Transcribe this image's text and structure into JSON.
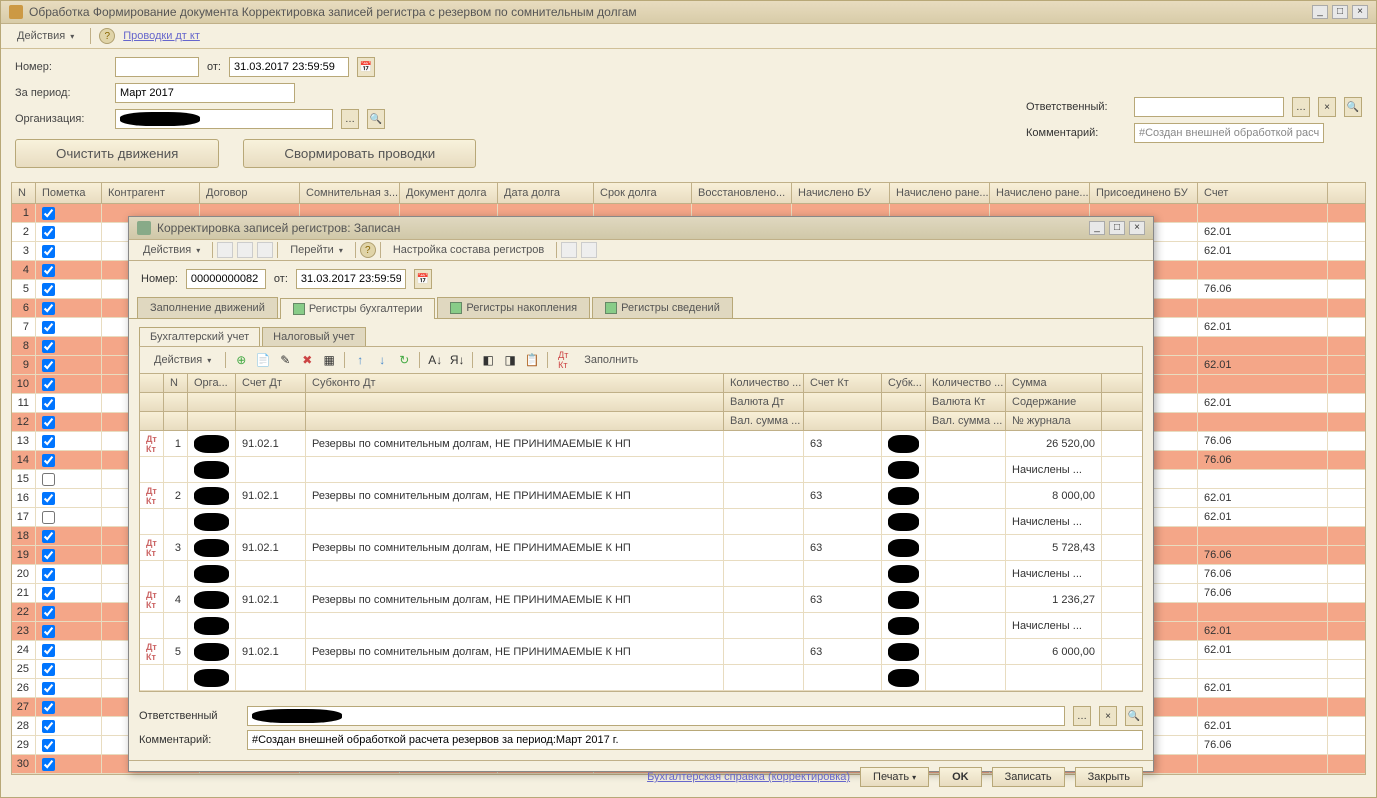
{
  "main": {
    "title": "Обработка  Формирование документа Корректировка записей регистра с резервом по сомнительным долгам",
    "toolbar": {
      "actions": "Действия",
      "link": "Проводки дт кт"
    },
    "form": {
      "number_label": "Номер:",
      "from_label": "от:",
      "from_value": "31.03.2017 23:59:59",
      "period_label": "За период:",
      "period_value": "Март 2017",
      "org_label": "Организация:",
      "responsible_label": "Ответственный:",
      "comment_label": "Комментарий:",
      "comment_value": "#Создан внешней обработкой расче",
      "btn_clear": "Очистить движения",
      "btn_form": "Свормировать проводки"
    },
    "grid": {
      "headers": [
        "N",
        "Пометка",
        "Контрагент",
        "Договор",
        "Сомнительная з...",
        "Документ долга",
        "Дата долга",
        "Срок долга",
        "Восстановлено...",
        "Начислено БУ",
        "Начислено ране...",
        "Начислено ране...",
        "Присоединено БУ",
        "Счет"
      ],
      "rows": [
        {
          "n": 1,
          "chk": true,
          "hl": true,
          "acct": ""
        },
        {
          "n": 2,
          "chk": true,
          "hl": false,
          "acct": "62.01"
        },
        {
          "n": 3,
          "chk": true,
          "hl": false,
          "acct": "62.01"
        },
        {
          "n": 4,
          "chk": true,
          "hl": true,
          "acct": ""
        },
        {
          "n": 5,
          "chk": true,
          "hl": false,
          "acct": "76.06"
        },
        {
          "n": 6,
          "chk": true,
          "hl": true,
          "acct": ""
        },
        {
          "n": 7,
          "chk": true,
          "hl": false,
          "acct": "62.01"
        },
        {
          "n": 8,
          "chk": true,
          "hl": true,
          "acct": ""
        },
        {
          "n": 9,
          "chk": true,
          "hl": true,
          "acct": "62.01"
        },
        {
          "n": 10,
          "chk": true,
          "hl": true,
          "acct": ""
        },
        {
          "n": 11,
          "chk": true,
          "hl": false,
          "acct": "62.01"
        },
        {
          "n": 12,
          "chk": true,
          "hl": true,
          "acct": ""
        },
        {
          "n": 13,
          "chk": true,
          "hl": false,
          "acct": "76.06"
        },
        {
          "n": 14,
          "chk": true,
          "hl": true,
          "acct": "76.06"
        },
        {
          "n": 15,
          "chk": false,
          "hl": false,
          "acct": ""
        },
        {
          "n": 16,
          "chk": true,
          "hl": false,
          "acct": "62.01"
        },
        {
          "n": 17,
          "chk": false,
          "hl": false,
          "acct": "62.01"
        },
        {
          "n": 18,
          "chk": true,
          "hl": true,
          "acct": ""
        },
        {
          "n": 19,
          "chk": true,
          "hl": true,
          "acct": "76.06"
        },
        {
          "n": 20,
          "chk": true,
          "hl": false,
          "acct": "76.06"
        },
        {
          "n": 21,
          "chk": true,
          "hl": false,
          "acct": "76.06"
        },
        {
          "n": 22,
          "chk": true,
          "hl": true,
          "acct": ""
        },
        {
          "n": 23,
          "chk": true,
          "hl": true,
          "acct": "62.01"
        },
        {
          "n": 24,
          "chk": true,
          "hl": false,
          "acct": "62.01"
        },
        {
          "n": 25,
          "chk": true,
          "hl": false,
          "acct": ""
        },
        {
          "n": 26,
          "chk": true,
          "hl": false,
          "acct": "62.01"
        },
        {
          "n": 27,
          "chk": true,
          "hl": true,
          "acct": ""
        },
        {
          "n": 28,
          "chk": true,
          "hl": false,
          "acct": "62.01"
        },
        {
          "n": 29,
          "chk": true,
          "hl": false,
          "acct": "76.06"
        },
        {
          "n": 30,
          "chk": true,
          "hl": true,
          "acct": ""
        }
      ]
    }
  },
  "inner": {
    "title": "Корректировка записей регистров: Записан",
    "toolbar": {
      "actions": "Действия",
      "goto": "Перейти",
      "settings": "Настройка состава регистров"
    },
    "form": {
      "number_label": "Номер:",
      "number_value": "00000000082",
      "from_label": "от:",
      "from_value": "31.03.2017 23:59:59"
    },
    "tabs": [
      "Заполнение движений",
      "Регистры бухгалтерии",
      "Регистры накопления",
      "Регистры сведений"
    ],
    "subtabs": [
      "Бухгалтерский учет",
      "Налоговый учет"
    ],
    "actions_label": "Действия",
    "fill_label": "Заполнить",
    "grid": {
      "headers1": [
        "",
        "N",
        "Орга...",
        "Счет Дт",
        "Субконто Дт",
        "Количество ...",
        "Счет Кт",
        "Субк...",
        "Количество ...",
        "Сумма"
      ],
      "headers2": [
        "",
        "",
        "",
        "",
        "",
        "Валюта Дт",
        "",
        "",
        "Валюта Кт",
        "Содержание"
      ],
      "headers3": [
        "",
        "",
        "",
        "",
        "",
        "Вал. сумма ...",
        "",
        "",
        "Вал. сумма ...",
        "№ журнала"
      ],
      "rows": [
        {
          "n": 1,
          "dt": "91.02.1",
          "sub": "Резервы по сомнительным долгам, НЕ ПРИНИМАЕМЫЕ К НП",
          "kt": "63",
          "sum": "26 520,00",
          "cont": "Начислены ..."
        },
        {
          "n": 2,
          "dt": "91.02.1",
          "sub": "Резервы по сомнительным долгам, НЕ ПРИНИМАЕМЫЕ К НП",
          "kt": "63",
          "sum": "8 000,00",
          "cont": "Начислены ..."
        },
        {
          "n": 3,
          "dt": "91.02.1",
          "sub": "Резервы по сомнительным долгам, НЕ ПРИНИМАЕМЫЕ К НП",
          "kt": "63",
          "sum": "5 728,43",
          "cont": "Начислены ..."
        },
        {
          "n": 4,
          "dt": "91.02.1",
          "sub": "Резервы по сомнительным долгам, НЕ ПРИНИМАЕМЫЕ К НП",
          "kt": "63",
          "sum": "1 236,27",
          "cont": "Начислены ..."
        },
        {
          "n": 5,
          "dt": "91.02.1",
          "sub": "Резервы по сомнительным долгам, НЕ ПРИНИМАЕМЫЕ К НП",
          "kt": "63",
          "sum": "6 000,00",
          "cont": ""
        }
      ]
    },
    "bottom": {
      "responsible_label": "Ответственный",
      "comment_label": "Комментарий:",
      "comment_value": "#Создан внешней обработкой расчета резервов за период:Март 2017 г."
    },
    "bottombar": {
      "link": "Бухгалтерская справка (корректировка)",
      "print": "Печать",
      "ok": "OK",
      "save": "Записать",
      "close": "Закрыть"
    }
  }
}
